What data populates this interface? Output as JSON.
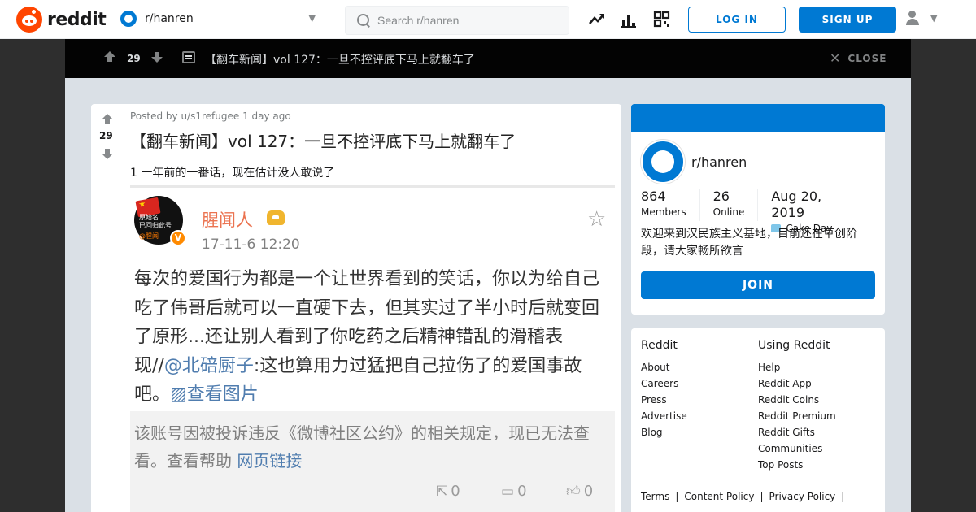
{
  "header": {
    "logo_text": "reddit",
    "subreddit": "r/hanren",
    "search_placeholder": "Search r/hanren",
    "login_label": "LOG IN",
    "signup_label": "SIGN UP"
  },
  "post_bar": {
    "votes": "29",
    "title": "【翻车新闻】vol 127：一旦不控评底下马上就翻车了",
    "close_label": "CLOSE"
  },
  "post": {
    "votes": "29",
    "posted_by": "Posted by u/s1refugee 1 day ago",
    "title": "【翻车新闻】vol 127：一旦不控评底下马上就翻车了",
    "body": "1 一年前的一番话，现在估计没人敢说了"
  },
  "weibo": {
    "avatar_text": "原始名\n已回归此号",
    "avatar_handle": "@腥闻",
    "verified_badge": "V",
    "author": "腥闻人",
    "time": "17-11-6 12:20",
    "text_before": "每次的爱国行为都是一个让世界看到的笑话，你以为给自己吃了伟哥后就可以一直硬下去，但其实过了半小时后就变回了原形...还让别人看到了你吃药之后精神错乱的滑稽表现//",
    "mention": "@北碚厨子",
    "text_after": ":这也算用力过猛把自己拉伤了的爱国事故吧。",
    "view_image": "▨查看图片",
    "repost_text": "该账号因被投诉违反《微博社区公约》的相关规定，现已无法查看。查看帮助 ",
    "repost_link": "网页链接",
    "share_count": "0",
    "comment_count": "0",
    "like_count": "0"
  },
  "sidebar": {
    "name": "r/hanren",
    "members_value": "864",
    "members_label": "Members",
    "online_value": "26",
    "online_label": "Online",
    "cake_value": "Aug 20, 2019",
    "cake_label": "Cake Day",
    "description": "欢迎来到汉民族主义基地，目前还在草创阶段，请大家畅所欲言",
    "join_label": "JOIN"
  },
  "footer": {
    "col1_title": "Reddit",
    "col1_links": [
      "About",
      "Careers",
      "Press",
      "Advertise",
      "Blog"
    ],
    "col2_title": "Using Reddit",
    "col2_links": [
      "Help",
      "Reddit App",
      "Reddit Coins",
      "Reddit Premium",
      "Reddit Gifts",
      "Communities",
      "Top Posts"
    ],
    "bottom_links": [
      "Terms",
      "Content Policy",
      "Privacy Policy"
    ]
  },
  "colors": {
    "brand": "#ff4500",
    "accent": "#0079d3",
    "postbar_bg": "#030303",
    "page_bg": "#dae0e6"
  }
}
